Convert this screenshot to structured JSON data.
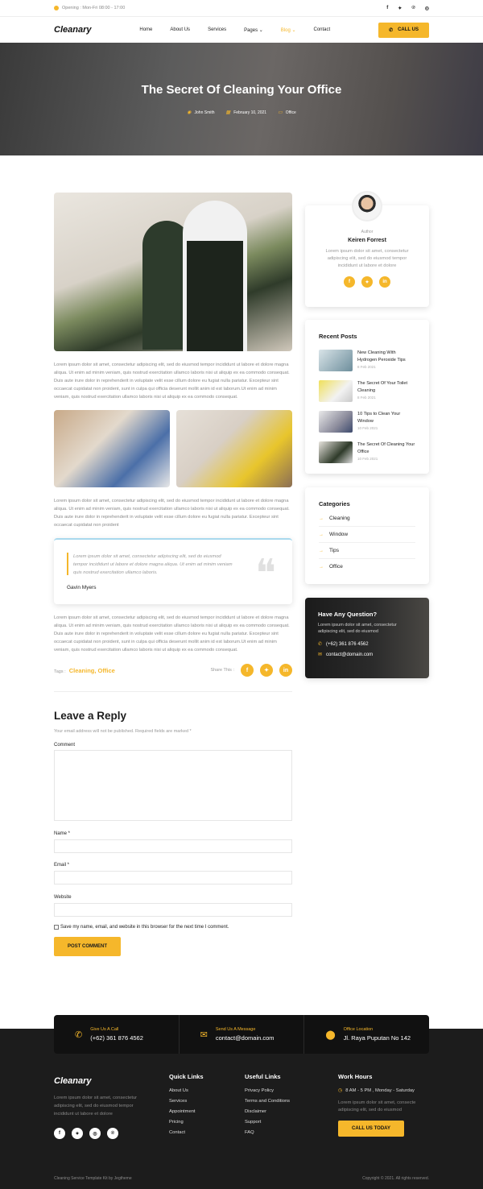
{
  "topbar": {
    "opening": "Opening : Mon-Fri 08:00 - 17:00",
    "social_f": "f",
    "social_t": "✦",
    "social_p": "℗",
    "social_i": "◎"
  },
  "nav": {
    "logo": "Cleanary",
    "items": [
      "Home",
      "About Us",
      "Services",
      "Pages ⌄",
      "Blog ⌄",
      "Contact"
    ],
    "call_label": "CALL US"
  },
  "hero": {
    "title": "The Secret Of Cleaning Your Office",
    "author": "John Smith",
    "date": "February 10, 2021",
    "category": "Office"
  },
  "article": {
    "para1": "Lorem ipsum dolor sit amet, consectetur adipiscing elit, sed do eiusmod tempor incididunt ut labore et dolore magna aliqua. Ut enim ad minim veniam, quis nostrud exercitation ullamco laboris nisi ut aliquip ex ea commodo consequat. Duis aute irure dolor in reprehenderit in voluptate velit esse cillum dolore eu fugiat nulla pariatur. Excepteur sint occaecat cupidatat non proident, sunt in culpa qui officia deserunt mollit anim id est laborum.Ut enim ad minim veniam, quis nostrud exercitation ullamco laboris nisi ut aliquip ex ea commodo consequat.",
    "para2": "Lorem ipsum dolor sit amet, consectetur adipiscing elit, sed do eiusmod tempor incididunt ut labore et dolore magna aliqua. Ut enim ad minim veniam, quis nostrud exercitation ullamco laboris nisi ut aliquip ex ea commodo consequat. Duis aute irure dolor in reprehenderit in voluptate velit esse cillum dolore eu fugiat nulla pariatur. Excepteur sint occaecat cupidatat non proident",
    "quote": "Lorem ipsum dolor sit amet, consectetur adipiscing elit, sed do eiusmod tempor incididunt ut labore et dolore magna aliqua. Ut enim ad minim veniam quis nostrud exercitation ullamco laboris.",
    "quote_author": "Gavin Myers",
    "para3": "Lorem ipsum dolor sit amet, consectetur adipiscing elit, sed do eiusmod tempor incididunt ut labore et dolore magna aliqua. Ut enim ad minim veniam, quis nostrud exercitation ullamco laboris nisi ut aliquip ex ea commodo consequat. Duis aute irure dolor in reprehenderit in voluptate velit esse cillum dolore eu fugiat nulla pariatur. Excepteur sint occaecat cupidatat non proident, sunt in culpa qui officia deserunt mollit anim id est laborum.Ut enim ad minim veniam, quis nostrud exercitation ullamco laboris nisi ut aliquip ex ea commodo consequat.",
    "tags_label": "Tags :",
    "tags": "Cleaning, Office",
    "share_label": "Share This :"
  },
  "reply": {
    "title": "Leave a Reply",
    "note": "Your email address will not be published. Required fields are marked *",
    "comment_label": "Comment",
    "name_label": "Name *",
    "email_label": "Email *",
    "website_label": "Website",
    "save_label": "Save my name, email, and website in this browser for the next time I comment.",
    "post_label": "POST COMMENT"
  },
  "author": {
    "label": "Author",
    "name": "Keiren Forrest",
    "desc": "Lorem ipsum dolor sit amet, consectetur adipiscing elit, sed do eiusmod tempor incididunt ut labore et dolore"
  },
  "recent": {
    "title": "Recent Posts",
    "posts": [
      {
        "title": "New Cleaning With Hydrogen Peroxide Tips",
        "date": "8 Feb 2021"
      },
      {
        "title": "The Secret Of Your Toilet Cleaning",
        "date": "8 Feb 2021"
      },
      {
        "title": "10 Tips to Clean Your Window",
        "date": "10 Feb 2021"
      },
      {
        "title": "The Secret Of Cleaning Your Office",
        "date": "10 Feb 2021"
      }
    ]
  },
  "categories": {
    "title": "Categories",
    "items": [
      "Cleaning",
      "Window",
      "Tips",
      "Office"
    ]
  },
  "ask": {
    "title": "Have Any Question?",
    "desc": "Lorem ipsum dolor sit amet, consectetur adipiscing elit, sed do eiusmod",
    "phone": "(+62) 361 876 4562",
    "email": "contact@domain.com"
  },
  "contact": {
    "call_label": "Give Us A Call",
    "call_value": "(+62) 361 876 4562",
    "msg_label": "Send Us A Message",
    "msg_value": "contact@domain.com",
    "loc_label": "Office Location",
    "loc_value": "Jl. Raya Puputan No 142"
  },
  "footer": {
    "logo": "Cleanary",
    "desc": "Lorem ipsum dolor sit amet, consectetur adipiscing elit, sed do eiusmod tempor incididunt ut labore et dolore",
    "quick_title": "Quick Links",
    "quick": [
      "About Us",
      "Services",
      "Appointment",
      "Pricing",
      "Contact"
    ],
    "useful_title": "Useful Links",
    "useful": [
      "Privacy Policy",
      "Terms and Conditions",
      "Disclaimer",
      "Support",
      "FAQ"
    ],
    "hours_title": "Work Hours",
    "hours": "8 AM - 5 PM , Monday - Saturday",
    "hours_desc": "Lorem ipsum dolor sit amet, consecte adipiscing elit, sed do eiusmod",
    "hours_btn": "CALL US TODAY",
    "credit": "Cleaning Service Template Kit by Jegtheme",
    "copyright": "Copyright © 2021. All rights reserved."
  },
  "colors": {
    "accent": "#f5b72b",
    "dark": "#1c1c1c"
  }
}
